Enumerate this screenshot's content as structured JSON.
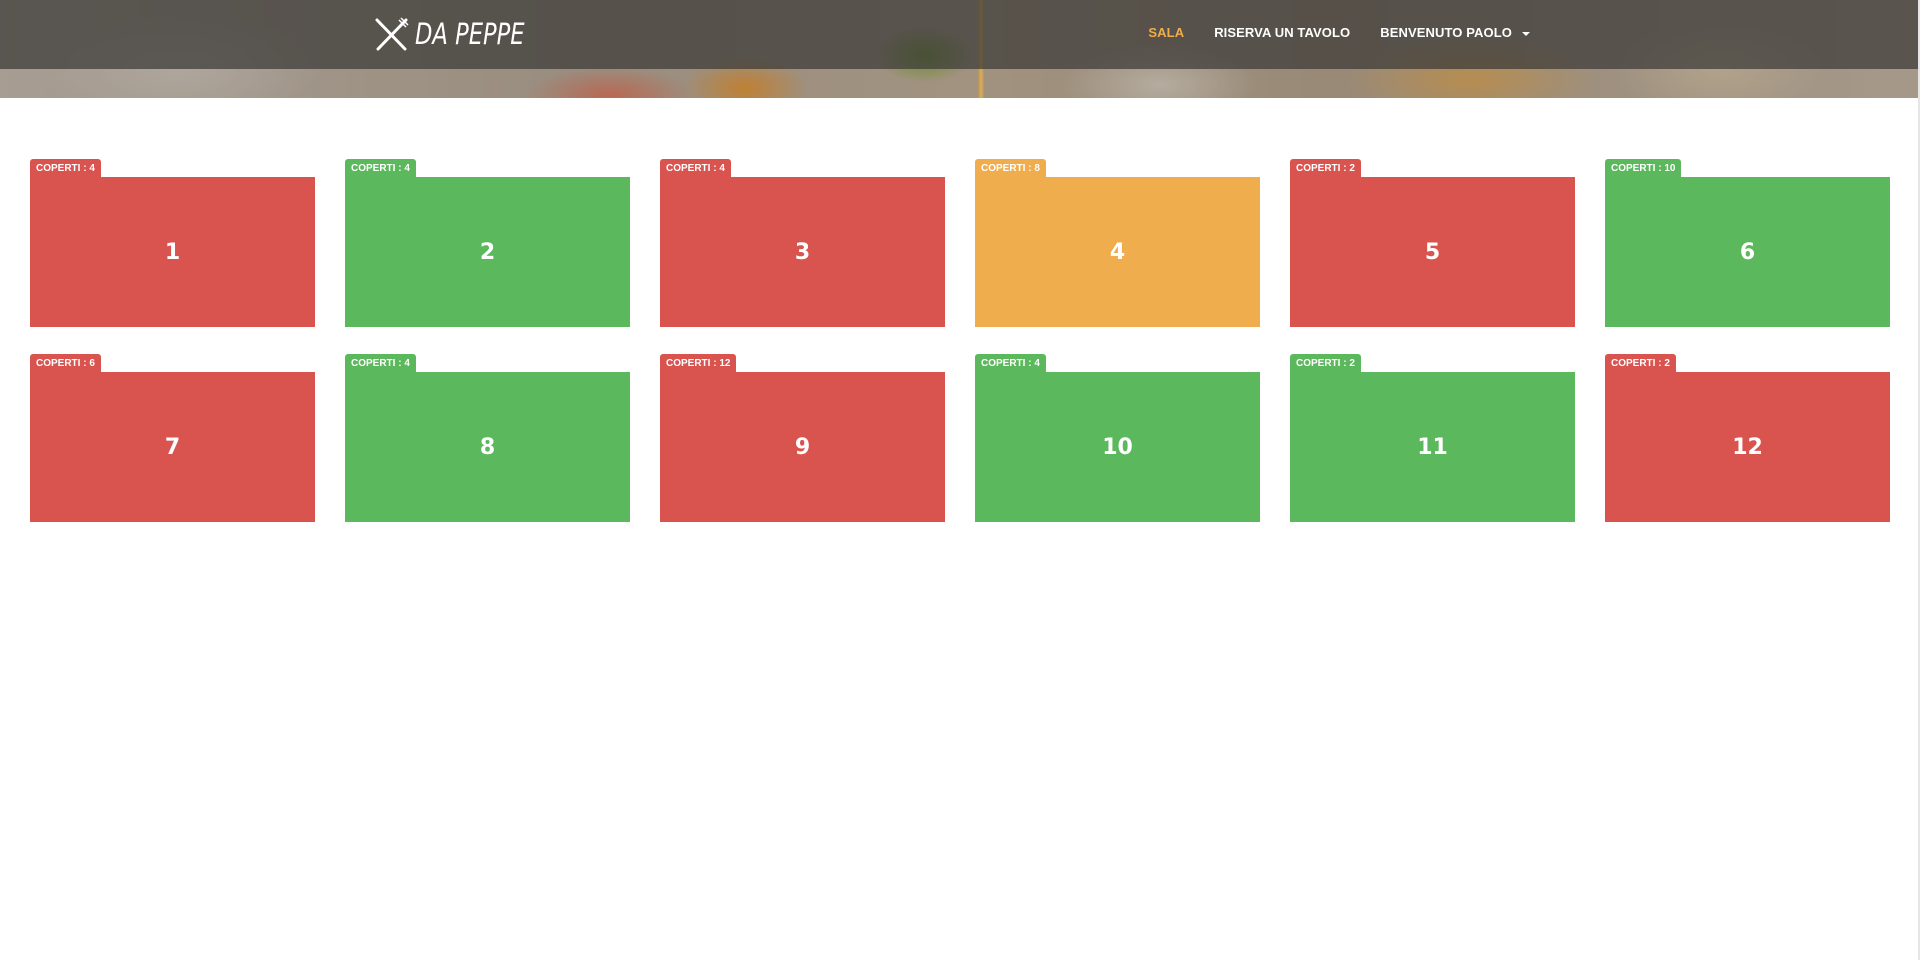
{
  "header": {
    "brand": "DA PEPPE",
    "brand_icon": "fork-knife-icon",
    "nav": [
      {
        "label": "SALA",
        "active": true
      },
      {
        "label": "RISERVA UN TAVOLO",
        "active": false
      },
      {
        "label": "BENVENUTO PAOLO",
        "active": false,
        "dropdown": true
      }
    ]
  },
  "colors": {
    "occupied": "#d9534f",
    "free": "#5cb85c",
    "reserved": "#f0ad4e",
    "active_nav": "#f0ad4e"
  },
  "tables": [
    {
      "number": "1",
      "covers": "COPERTI : 4",
      "status": "occupied"
    },
    {
      "number": "2",
      "covers": "COPERTI : 4",
      "status": "free"
    },
    {
      "number": "3",
      "covers": "COPERTI : 4",
      "status": "occupied"
    },
    {
      "number": "4",
      "covers": "COPERTI : 8",
      "status": "reserved"
    },
    {
      "number": "5",
      "covers": "COPERTI : 2",
      "status": "occupied"
    },
    {
      "number": "6",
      "covers": "COPERTI : 10",
      "status": "free"
    },
    {
      "number": "7",
      "covers": "COPERTI : 6",
      "status": "occupied"
    },
    {
      "number": "8",
      "covers": "COPERTI : 4",
      "status": "free"
    },
    {
      "number": "9",
      "covers": "COPERTI : 12",
      "status": "occupied"
    },
    {
      "number": "10",
      "covers": "COPERTI : 4",
      "status": "free"
    },
    {
      "number": "11",
      "covers": "COPERTI : 2",
      "status": "free"
    },
    {
      "number": "12",
      "covers": "COPERTI : 2",
      "status": "occupied"
    }
  ]
}
